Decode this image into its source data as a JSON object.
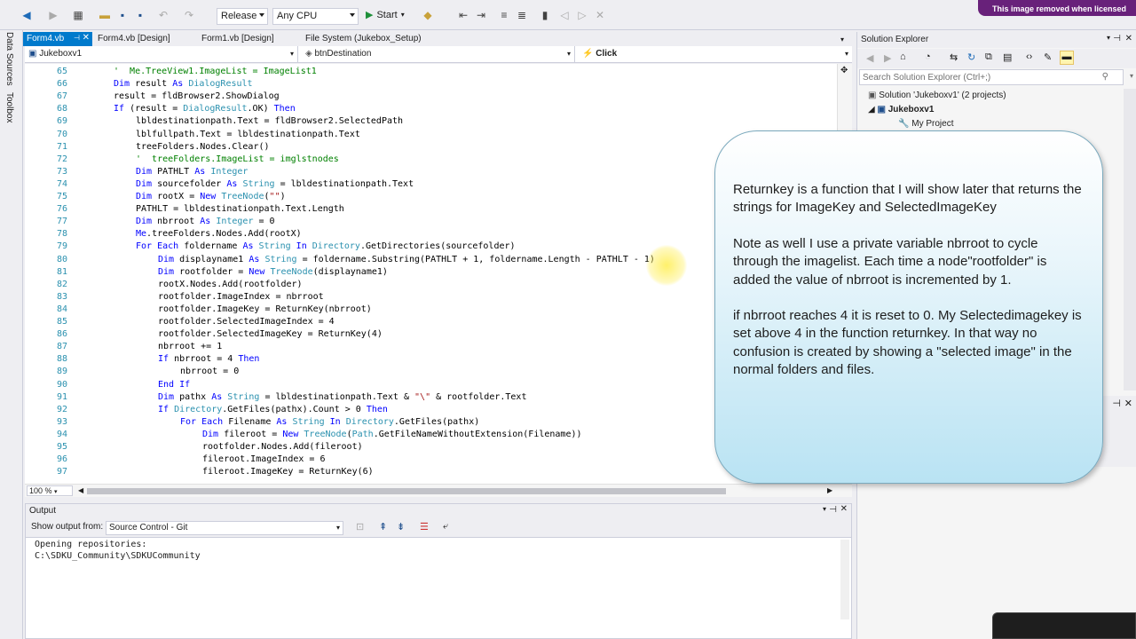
{
  "toolbar": {
    "config": "Release",
    "platform": "Any CPU",
    "start_label": "Start",
    "banner": "This image removed when licensed"
  },
  "left_strip": {
    "tabs": [
      "Data Sources",
      "Toolbox"
    ]
  },
  "doc_tabs": [
    {
      "label": "Form4.vb",
      "active": true
    },
    {
      "label": "Form4.vb [Design]"
    },
    {
      "label": "Form1.vb [Design]"
    },
    {
      "label": "File System (Jukebox_Setup)"
    }
  ],
  "nav": {
    "project": "Jukeboxv1",
    "object": "btnDestination",
    "event": "Click"
  },
  "editor": {
    "zoom": "100 %",
    "lines": [
      {
        "n": "65",
        "i": 2,
        "t": "'  Me.TreeView1.ImageList = ImageList1"
      },
      {
        "n": "66",
        "i": 2,
        "t": "Dim result As DialogResult"
      },
      {
        "n": "67",
        "i": 2,
        "t": "result = fldBrowser2.ShowDialog"
      },
      {
        "n": "68",
        "i": 2,
        "t": "If (result = DialogResult.OK) Then"
      },
      {
        "n": "69",
        "i": 3,
        "t": "lbldestinationpath.Text = fldBrowser2.SelectedPath"
      },
      {
        "n": "70",
        "i": 3,
        "t": "lblfullpath.Text = lbldestinationpath.Text"
      },
      {
        "n": "71",
        "i": 3,
        "t": "treeFolders.Nodes.Clear()"
      },
      {
        "n": "72",
        "i": 3,
        "t": "'  treeFolders.ImageList = imglstnodes"
      },
      {
        "n": "73",
        "i": 3,
        "t": "Dim PATHLT As Integer"
      },
      {
        "n": "74",
        "i": 3,
        "t": "Dim sourcefolder As String = lbldestinationpath.Text"
      },
      {
        "n": "75",
        "i": 3,
        "t": "Dim rootX = New TreeNode(\"\")"
      },
      {
        "n": "76",
        "i": 3,
        "t": "PATHLT = lbldestinationpath.Text.Length"
      },
      {
        "n": "77",
        "i": 3,
        "t": "Dim nbrroot As Integer = 0"
      },
      {
        "n": "78",
        "i": 3,
        "t": "Me.treeFolders.Nodes.Add(rootX)"
      },
      {
        "n": "79",
        "i": 3,
        "t": "For Each foldername As String In Directory.GetDirectories(sourcefolder)"
      },
      {
        "n": "80",
        "i": 4,
        "t": "Dim displayname1 As String = foldername.Substring(PATHLT + 1, foldername.Length - PATHLT - 1)"
      },
      {
        "n": "81",
        "i": 4,
        "t": "Dim rootfolder = New TreeNode(displayname1)"
      },
      {
        "n": "82",
        "i": 4,
        "t": "rootX.Nodes.Add(rootfolder)"
      },
      {
        "n": "83",
        "i": 4,
        "t": "rootfolder.ImageIndex = nbrroot"
      },
      {
        "n": "84",
        "i": 4,
        "t": "rootfolder.ImageKey = ReturnKey(nbrroot)"
      },
      {
        "n": "85",
        "i": 4,
        "t": "rootfolder.SelectedImageIndex = 4"
      },
      {
        "n": "86",
        "i": 4,
        "t": "rootfolder.SelectedImageKey = ReturnKey(4)"
      },
      {
        "n": "87",
        "i": 4,
        "t": "nbrroot += 1"
      },
      {
        "n": "88",
        "i": 4,
        "t": "If nbrroot = 4 Then"
      },
      {
        "n": "89",
        "i": 5,
        "t": "nbrroot = 0"
      },
      {
        "n": "90",
        "i": 4,
        "t": "End If"
      },
      {
        "n": "91",
        "i": 4,
        "t": "Dim pathx As String = lbldestinationpath.Text & \"\\\" & rootfolder.Text"
      },
      {
        "n": "92",
        "i": 4,
        "t": "If Directory.GetFiles(pathx).Count > 0 Then"
      },
      {
        "n": "93",
        "i": 5,
        "t": "For Each Filename As String In Directory.GetFiles(pathx)"
      },
      {
        "n": "94",
        "i": 6,
        "t": "Dim fileroot = New TreeNode(Path.GetFileNameWithoutExtension(Filename))"
      },
      {
        "n": "95",
        "i": 6,
        "t": "rootfolder.Nodes.Add(fileroot)"
      },
      {
        "n": "96",
        "i": 6,
        "t": "fileroot.ImageIndex = 6"
      },
      {
        "n": "97",
        "i": 6,
        "t": "fileroot.ImageKey = ReturnKey(6)"
      }
    ]
  },
  "solution_explorer": {
    "title": "Solution Explorer",
    "search_placeholder": "Search Solution Explorer (Ctrl+;)",
    "items": [
      {
        "label": "Solution 'Jukeboxv1' (2 projects)"
      },
      {
        "label": "Jukeboxv1"
      },
      {
        "label": "My Project"
      }
    ]
  },
  "callout": {
    "paragraphs": [
      "Returnkey is a function that I will show later that returns the strings for ImageKey and SelectedImageKey",
      "Note as well I use a private variable nbrroot to cycle through the imagelist.  Each time a node\"rootfolder\" is added the value of nbrroot is incremented by 1.",
      "if nbrroot reaches 4 it is reset to 0.  My Selectedimagekey is set above 4 in the function returnkey. In that way no confusion is created by showing a \"selected image\" in the normal folders and files."
    ]
  },
  "output": {
    "title": "Output",
    "show_from_label": "Show output from:",
    "source": "Source Control - Git",
    "lines": [
      "Opening repositories:",
      "C:\\SDKU_Community\\SDKUCommunity"
    ]
  }
}
